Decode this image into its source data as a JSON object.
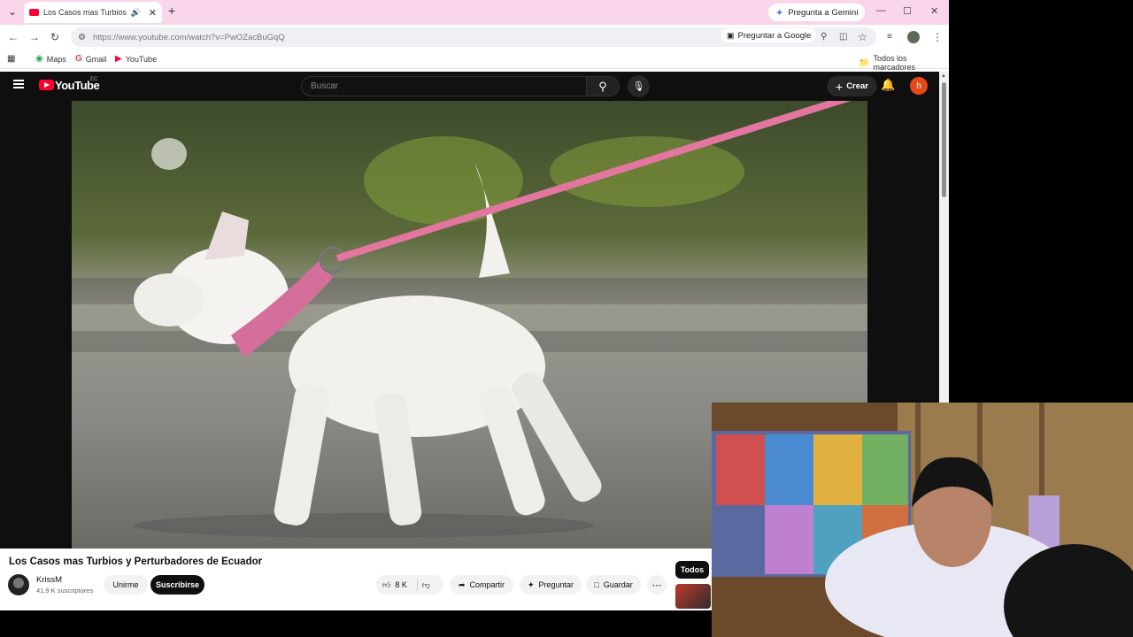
{
  "browser": {
    "tab_title": "Los Casos mas Turbios y Pe",
    "gemini_label": "Pregunta a Gemini",
    "url": "https://www.youtube.com/watch?v=PwOZacBuGqQ",
    "google_lens_label": "Preguntar a Google",
    "bookmarks": [
      {
        "label": "Maps",
        "icon": "maps-pin-icon"
      },
      {
        "label": "Gmail",
        "icon": "gmail-g-icon"
      },
      {
        "label": "YouTube",
        "icon": "youtube-icon"
      }
    ],
    "all_bookmarks_label": "Todos los marcadores"
  },
  "youtube": {
    "wordmark": "YouTube",
    "country": "EC",
    "search_placeholder": "Buscar",
    "create_label": "Crear",
    "avatar_letter": "h",
    "video": {
      "title": "Los Casos mas Turbios y Perturbadores de Ecuador",
      "channel": "KrissM",
      "subscribers": "41,9 K suscriptores",
      "join_label": "Unirme",
      "subscribe_label": "Suscribirse",
      "likes": "8 K",
      "share_label": "Compartir",
      "ask_label": "Preguntar",
      "save_label": "Guardar",
      "filter_chip": "Todos"
    }
  },
  "colors": {
    "tabstrip": "#f9d6ea",
    "youtube_red": "#ff0033",
    "avatar": "#e64a19"
  }
}
